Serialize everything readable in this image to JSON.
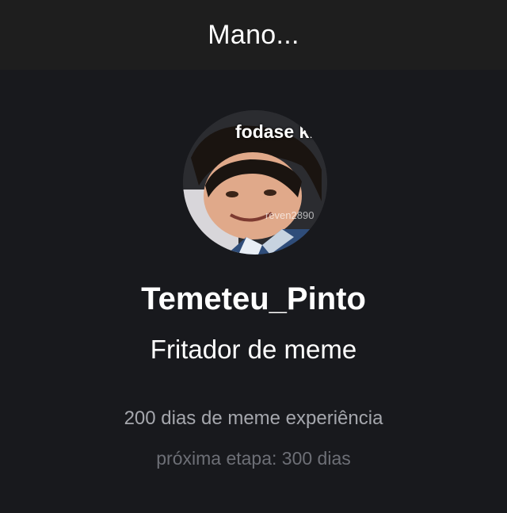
{
  "header": {
    "title": "Mano..."
  },
  "profile": {
    "avatar_caption": "fodase kk",
    "avatar_watermark": "reven2890",
    "username": "Temeteu_Pinto",
    "role": "Fritador de meme",
    "experience": "200 dias de meme experiência",
    "next_stage": "próxima etapa: 300 dias"
  }
}
